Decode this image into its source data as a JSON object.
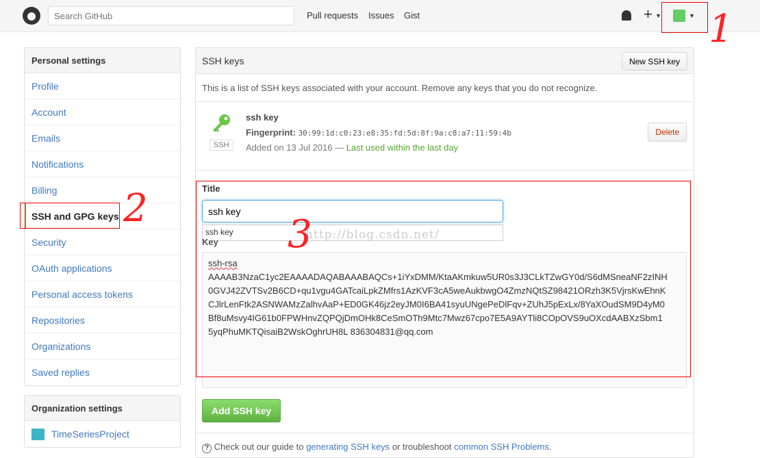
{
  "header": {
    "search_placeholder": "Search GitHub",
    "nav": [
      "Pull requests",
      "Issues",
      "Gist"
    ]
  },
  "annotations": [
    "1",
    "2",
    "3"
  ],
  "watermark": "http://blog.csdn.net/",
  "sidebar": {
    "title": "Personal settings",
    "items": [
      "Profile",
      "Account",
      "Emails",
      "Notifications",
      "Billing",
      "SSH and GPG keys",
      "Security",
      "OAuth applications",
      "Personal access tokens",
      "Repositories",
      "Organizations",
      "Saved replies"
    ],
    "selected": "SSH and GPG keys"
  },
  "org": {
    "title": "Organization settings",
    "items": [
      "TimeSeriesProject"
    ]
  },
  "main": {
    "title": "SSH keys",
    "new_button": "New SSH key",
    "description": "This is a list of SSH keys associated with your account. Remove any keys that you do not recognize.",
    "key": {
      "name": "ssh key",
      "badge": "SSH",
      "fingerprint_label": "Fingerprint:",
      "fingerprint": "30:99:1d:c0:23:e8:35:fd:5d:8f:9a:c8:a7:11:59:4b",
      "added": "Added on 13 Jul 2016 —",
      "last_used": "Last used within the last day",
      "delete": "Delete"
    },
    "form": {
      "title_label": "Title",
      "title_value": "ssh key",
      "autocomplete": "ssh key",
      "key_label": "Key",
      "key_lines": [
        "ssh-rsa",
        "AAAAB3NzaC1yc2EAAAADAQABAAABAQCs+1iYxDMM/KtaAKmkuw5UR0s3J3CLkTZwGY0d/S6dMSneaNF2zINH",
        "0GVJ42ZVTSv2B6CD+qu1vgu4GATcaiLpkZMfrs1AzKVF3cA5weAukbwgO4ZmzNQtSZ98421ORzh3K5VjrsKwEhnK",
        "CJlrLenFtk2ASNWAMzZalhvAaP+ED0GK46jz2eyJM0I6BA41syuUNgePeDlFqv+ZUhJ5pExLx/8YaXOudSM9D4yM0",
        "Bf8uMsvy4IG61b0FPWHnvZQPQjDmOHk8CeSmOTh9Mtc7Mwz67cpo7E5A9AYTli8COpOVS9uOXcdAABXzSbm1",
        "5yqPhuMKTQisaiB2WskOghrUH8L 836304831@qq.com"
      ],
      "add_button": "Add SSH key"
    },
    "footer": {
      "prefix": "Check out our guide to",
      "link1": "generating SSH keys",
      "middle": "or troubleshoot",
      "link2": "common SSH Problems",
      "suffix": "."
    }
  },
  "colors": {
    "link": "#4078c0",
    "green": "#6cc644",
    "annotation": "#ff2222",
    "delete": "#bd2c00"
  }
}
